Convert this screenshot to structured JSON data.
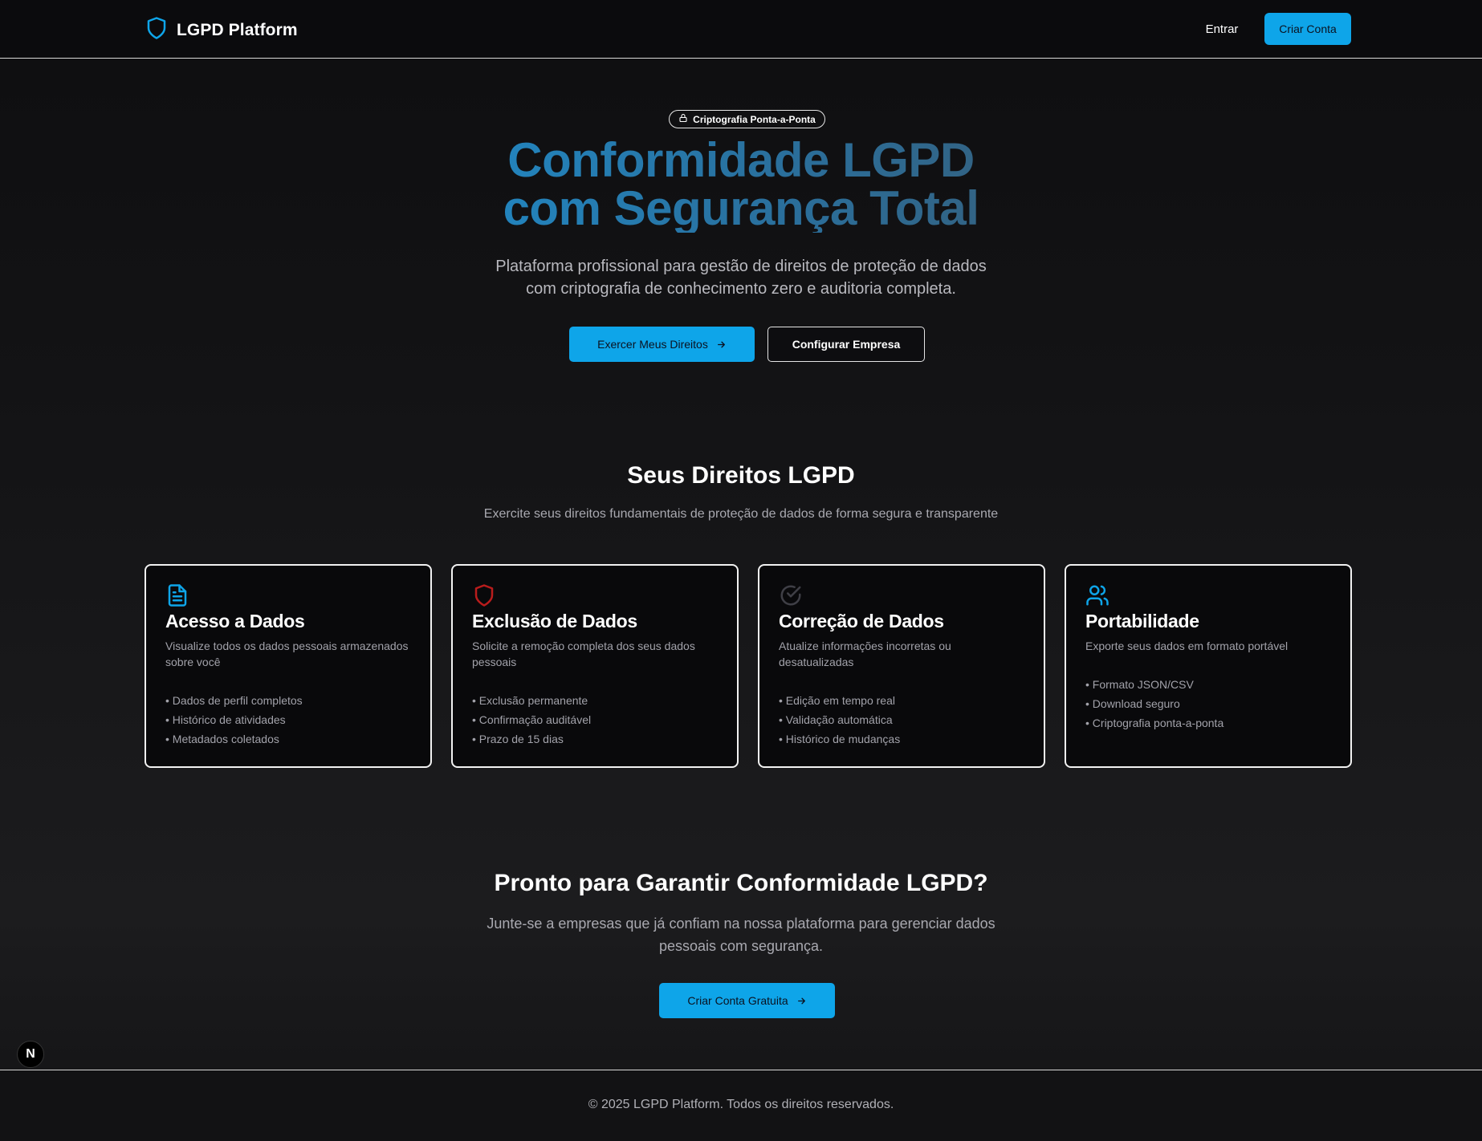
{
  "header": {
    "brand": "LGPD Platform",
    "login_label": "Entrar",
    "signup_label": "Criar Conta"
  },
  "hero": {
    "badge": "Criptografia Ponta-a-Ponta",
    "title_line1": "Conformidade LGPD",
    "title_line2": "com Segurança Total",
    "subtitle_line1": "Plataforma profissional para gestão de direitos de proteção de dados",
    "subtitle_line2": "com criptografia de conhecimento zero e auditoria completa.",
    "primary_button": "Exercer Meus Direitos",
    "secondary_button": "Configurar Empresa"
  },
  "rights": {
    "title": "Seus Direitos LGPD",
    "subtitle": "Exercite seus direitos fundamentais de proteção de dados de forma segura e transparente",
    "cards": [
      {
        "icon": "file-text-icon",
        "icon_color": "#0ea5e9",
        "title": "Acesso a Dados",
        "desc": "Visualize todos os dados pessoais armazenados sobre você",
        "items": [
          "• Dados de perfil completos",
          "• Histórico de atividades",
          "• Metadados coletados"
        ]
      },
      {
        "icon": "shield-icon",
        "icon_color": "#b91c1c",
        "title": "Exclusão de Dados",
        "desc": "Solicite a remoção completa dos seus dados pessoais",
        "items": [
          "• Exclusão permanente",
          "• Confirmação auditável",
          "• Prazo de 15 dias"
        ]
      },
      {
        "icon": "check-circle-icon",
        "icon_color": "#3f3f46",
        "title": "Correção de Dados",
        "desc": "Atualize informações incorretas ou desatualizadas",
        "items": [
          "• Edição em tempo real",
          "• Validação automática",
          "• Histórico de mudanças"
        ]
      },
      {
        "icon": "users-icon",
        "icon_color": "#0ea5e9",
        "title": "Portabilidade",
        "desc": "Exporte seus dados em formato portável",
        "items": [
          "• Formato JSON/CSV",
          "• Download seguro",
          "• Criptografia ponta-a-ponta"
        ]
      }
    ]
  },
  "cta": {
    "title": "Pronto para Garantir Conformidade LGPD?",
    "subtitle_line1": "Junte-se a empresas que já confiam na nossa plataforma para gerenciar dados",
    "subtitle_line2": "pessoais com segurança.",
    "button": "Criar Conta Gratuita"
  },
  "dev_badge": "N",
  "footer": {
    "text": "© 2025 LGPD Platform. Todos os direitos reservados."
  },
  "colors": {
    "accent": "#0ea5e9",
    "background": "#0e0e10",
    "danger": "#b91c1c"
  }
}
